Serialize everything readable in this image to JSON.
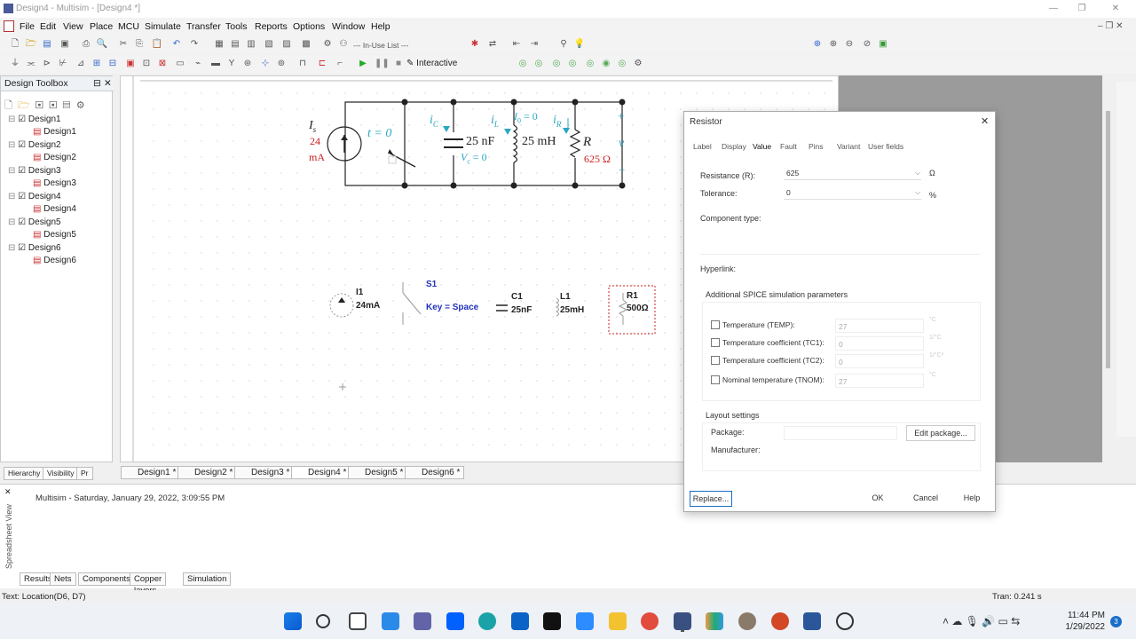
{
  "window": {
    "title": "Design4 - Multisim - [Design4 *]"
  },
  "menu": [
    "File",
    "Edit",
    "View",
    "Place",
    "MCU",
    "Simulate",
    "Transfer",
    "Tools",
    "Reports",
    "Options",
    "Window",
    "Help"
  ],
  "toolbar": {
    "in_use_list": "--- In-Use List ---",
    "interactive": "Interactive"
  },
  "sidebar": {
    "title": "Design Toolbox",
    "designs": [
      "Design1",
      "Design2",
      "Design3",
      "Design4",
      "Design5",
      "Design6"
    ],
    "tabs": [
      "Hierarchy",
      "Visibility",
      "Pr"
    ]
  },
  "circuit": {
    "is_label": "I",
    "is_sub": "s",
    "is_value": "24",
    "is_unit": "mA",
    "switch_label": "t = 0",
    "ic": "i",
    "ic_sub": "C",
    "cap_value": "25 nF",
    "vc": "V",
    "vc_sub": "c",
    "vc_rest": " = 0",
    "il": "i",
    "il_sub": "L",
    "io": "I",
    "io_sub": "0",
    "io_rest": " = 0",
    "ind_value": "25 mH",
    "ir": "i",
    "ir_sub": "R",
    "res_sym": "R",
    "res_value": "625 Ω",
    "plus": "+",
    "v": "v",
    "minus": "−"
  },
  "schematic": {
    "i1_name": "I1",
    "i1_value": "24mA",
    "s1_name": "S1",
    "s1_key": "Key = Space",
    "c1_name": "C1",
    "c1_value": "25nF",
    "l1_name": "L1",
    "l1_value": "25mH",
    "r1_name": "R1",
    "r1_value": "500Ω"
  },
  "design_tabs": [
    "Design1 *",
    "Design2 *",
    "Design3 *",
    "Design4 *",
    "Design5 *",
    "Design6 *"
  ],
  "spreadsheet": {
    "side_label": "Spreadsheet View",
    "log": "Multisim  -  Saturday, January 29, 2022, 3:09:55 PM",
    "tabs": [
      "Results",
      "Nets",
      "Components",
      "Copper layers",
      "Simulation"
    ]
  },
  "status": {
    "left": "Text: Location(D6, D7)",
    "right": "Tran: 0.241 s"
  },
  "dialog": {
    "title": "Resistor",
    "tabs": [
      "Label",
      "Display",
      "Value",
      "Fault",
      "Pins",
      "Variant",
      "User fields"
    ],
    "resistance_label": "Resistance (R):",
    "resistance_value": "625",
    "resistance_unit": "Ω",
    "tolerance_label": "Tolerance:",
    "tolerance_value": "0",
    "tolerance_unit": "%",
    "component_type": "Component type:",
    "hyperlink": "Hyperlink:",
    "spice_title": "Additional SPICE simulation parameters",
    "params": [
      {
        "label": "Temperature (TEMP):",
        "value": "27",
        "unit": "°C"
      },
      {
        "label": "Temperature coefficient (TC1):",
        "value": "0",
        "unit": "1/°C"
      },
      {
        "label": "Temperature coefficient (TC2):",
        "value": "0",
        "unit": "1/°C²"
      },
      {
        "label": "Nominal temperature (TNOM):",
        "value": "27",
        "unit": "°C"
      }
    ],
    "layout_title": "Layout settings",
    "package_label": "Package:",
    "manufacturer_label": "Manufacturer:",
    "edit_package": "Edit package...",
    "replace": "Replace...",
    "ok": "OK",
    "cancel": "Cancel",
    "help": "Help"
  },
  "taskbar": {
    "time": "11:44 PM",
    "date": "1/29/2022",
    "badge": "3"
  }
}
